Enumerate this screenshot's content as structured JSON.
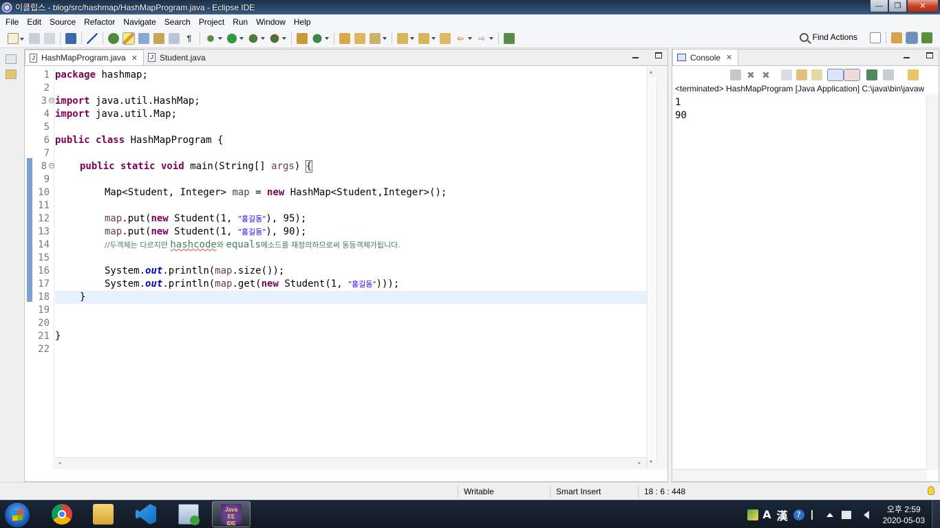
{
  "window": {
    "title": "이클립스 - blog/src/hashmap/HashMapProgram.java - Eclipse IDE",
    "controls": {
      "minimize": "—",
      "maximize": "❐",
      "close": "✕"
    }
  },
  "menu": [
    "File",
    "Edit",
    "Source",
    "Refactor",
    "Navigate",
    "Search",
    "Project",
    "Run",
    "Window",
    "Help"
  ],
  "toolbar": {
    "find_actions_label": "Find Actions"
  },
  "editor": {
    "tabs": [
      {
        "label": "HashMapProgram.java",
        "active": true,
        "closable": true
      },
      {
        "label": "Student.java",
        "active": false,
        "closable": false
      }
    ],
    "current_line": 18,
    "line_numbers": [
      "1",
      "2",
      "3",
      "4",
      "5",
      "6",
      "7",
      "8",
      "9",
      "10",
      "11",
      "12",
      "13",
      "14",
      "15",
      "16",
      "17",
      "18",
      "19",
      "20",
      "21",
      "22"
    ],
    "code": {
      "l1_kw": "package",
      "l1_rest": " hashmap;",
      "l3_kw": "import",
      "l3_rest": " java.util.HashMap;",
      "l4_kw": "import",
      "l4_rest": " java.util.Map;",
      "l6_kw": "public class",
      "l6_rest": " HashMapProgram {",
      "l8_kw": "public static void",
      "l8_a": " main(String[] ",
      "l8_var": "args",
      "l8_b": ") ",
      "l8_brace": "{",
      "l10_a": "Map<Student, Integer> ",
      "l10_var": "map",
      "l10_b": " = ",
      "l10_kw": "new",
      "l10_c": " HashMap<Student,Integer>();",
      "l12_var": "map",
      "l12_a": ".put(",
      "l12_kw": "new",
      "l12_b": " Student(1, ",
      "l12_str": "\"홍길동\"",
      "l12_c": "), 95);",
      "l13_var": "map",
      "l13_a": ".put(",
      "l13_kw": "new",
      "l13_b": " Student(1, ",
      "l13_str": "\"홍길동\"",
      "l13_c": "), 90);",
      "l14_a": "//두객체는 다르지만 ",
      "l14_sq": "hashcode",
      "l14_b": "와 ",
      "l14_c": "equals",
      "l14_d": "메소드를 재정의하므로써 동등객체가됩니다.",
      "l16_a": "System.",
      "l16_field": "out",
      "l16_b": ".println(",
      "l16_var": "map",
      "l16_c": ".size());",
      "l17_a": "System.",
      "l17_field": "out",
      "l17_b": ".println(",
      "l17_var": "map",
      "l17_c": ".get(",
      "l17_kw": "new",
      "l17_d": " Student(1, ",
      "l17_str": "\"홍길동\"",
      "l17_e": ")));",
      "l18": "}",
      "l21": "}"
    }
  },
  "console": {
    "tab_label": "Console",
    "status": "<terminated> HashMapProgram [Java Application] C:\\java\\bin\\javaw",
    "output": [
      "1",
      "90"
    ]
  },
  "statusbar": {
    "writable": "Writable",
    "insert_mode": "Smart Insert",
    "position": "18 : 6 : 448"
  },
  "taskbar": {
    "apps": [
      "chrome-icon",
      "explorer-icon",
      "vscode-icon",
      "device-manager-icon",
      "eclipse-java-ee-icon"
    ],
    "eclipse_label_top": "Java EE",
    "eclipse_label_bottom": "IDE",
    "tray": {
      "ime_a": "A",
      "ime_han": "漢",
      "help": "?"
    },
    "clock_time": "오후 2:59",
    "clock_date": "2020-05-03"
  },
  "colors": {
    "keyword": "#7f0055",
    "string": "#2a00ff",
    "comment": "#3f7f5f",
    "field": "#0000c0",
    "local_var": "#6a3e3e",
    "current_line": "#e8f2fe"
  }
}
